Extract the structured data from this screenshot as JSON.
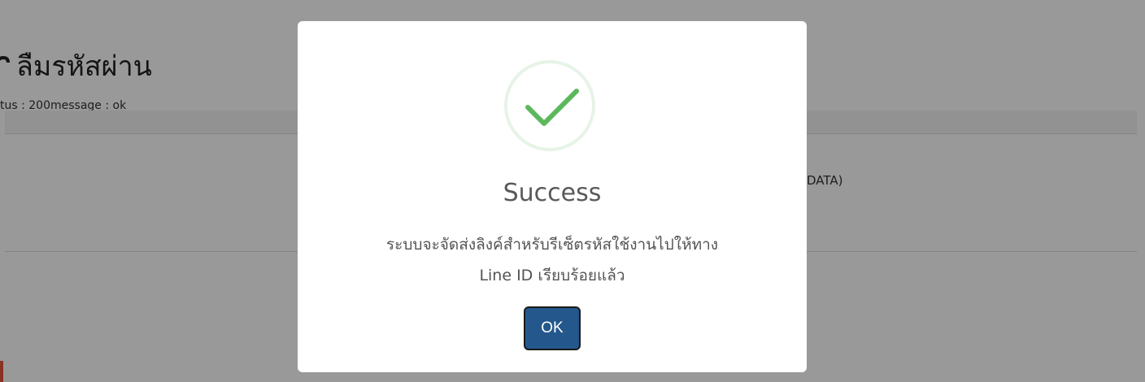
{
  "page": {
    "title": "ลืมรหัสผ่าน",
    "status_text": "tus : 200message : ok",
    "field_note": "DATA)"
  },
  "modal": {
    "icon": "success-check-icon",
    "title": "Success",
    "message_line1": "ระบบจะจัดส่งลิงค์สำหรับรีเซ็ตรหัสใช้งานไปให้ทาง",
    "message_line2": "Line ID เรียบร้อยแล้ว",
    "ok_label": "OK"
  },
  "colors": {
    "overlay": "rgba(0,0,0,0.4)",
    "success_green": "#5cb85c",
    "success_ring": "#e7f3e7",
    "ok_button": "#24588c",
    "accent": "#e5553d"
  }
}
